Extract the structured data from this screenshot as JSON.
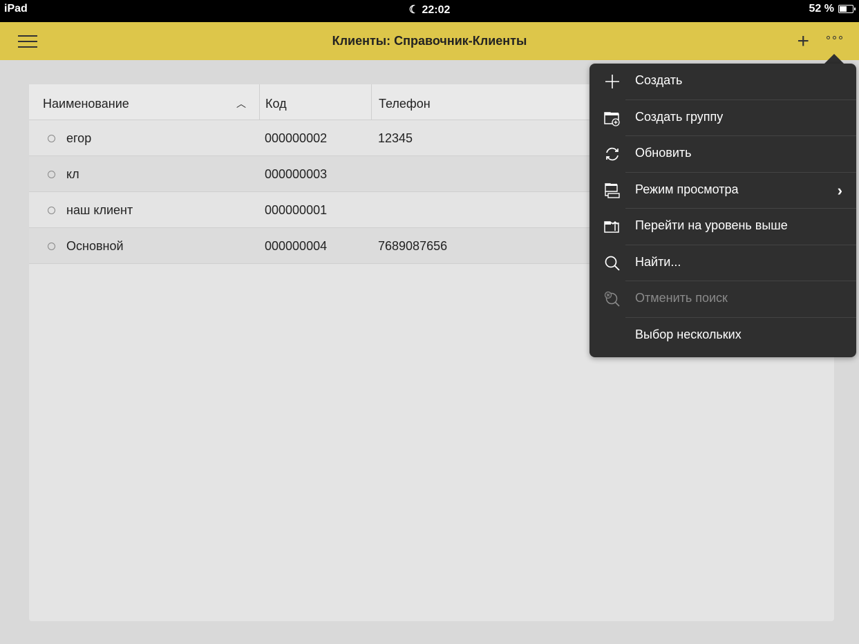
{
  "status_bar": {
    "device": "iPad",
    "time": "22:02",
    "battery": "52 %"
  },
  "navbar": {
    "title": "Клиенты: Справочник-Клиенты"
  },
  "table": {
    "columns": [
      "Наименование",
      "Код",
      "Телефон"
    ],
    "rows": [
      {
        "name": "егор",
        "code": "000000002",
        "phone": "12345"
      },
      {
        "name": "кл",
        "code": "000000003",
        "phone": ""
      },
      {
        "name": "наш клиент",
        "code": "000000001",
        "phone": ""
      },
      {
        "name": "Основной",
        "code": "000000004",
        "phone": "7689087656"
      }
    ]
  },
  "menu": {
    "items": [
      {
        "label": "Создать",
        "icon": "plus-icon",
        "enabled": true
      },
      {
        "label": "Создать группу",
        "icon": "folder-add-icon",
        "enabled": true
      },
      {
        "label": "Обновить",
        "icon": "refresh-icon",
        "enabled": true
      },
      {
        "label": "Режим просмотра",
        "icon": "view-mode-icon",
        "enabled": true,
        "has_submenu": true
      },
      {
        "label": "Перейти на уровень выше",
        "icon": "folder-up-icon",
        "enabled": true
      },
      {
        "label": "Найти...",
        "icon": "search-icon",
        "enabled": true
      },
      {
        "label": "Отменить поиск",
        "icon": "cancel-search-icon",
        "enabled": false
      },
      {
        "label": "Выбор нескольких",
        "icon": "",
        "enabled": true
      }
    ]
  },
  "colors": {
    "navbar": "#ddc64a",
    "menu_bg": "#2f2f2f",
    "page_bg": "#d9d9d9"
  }
}
